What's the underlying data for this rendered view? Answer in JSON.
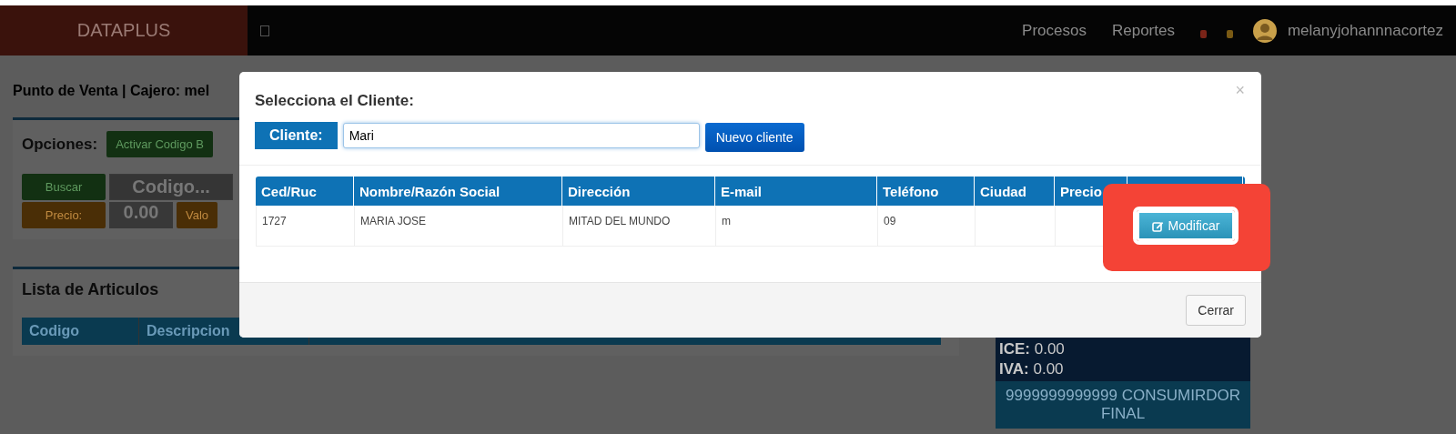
{
  "navbar": {
    "brand": "DATAPLUS",
    "menu": [
      "Procesos",
      "Reportes"
    ],
    "badges": [
      {
        "color": "#7a2418"
      },
      {
        "color": "#7a5a14"
      }
    ],
    "user": "melanyjohannnacortez"
  },
  "page": {
    "title": "Punto de Venta | Cajero: mel",
    "options_label": "Opciones:",
    "barcode_button": "Activar Codigo B",
    "search_button": "Buscar",
    "code_placeholder": "Codigo...",
    "price_button": "Precio:",
    "price_value": "0.00",
    "value_button": "Valo",
    "list_title": "Lista de Articulos",
    "list_columns": [
      "Codigo",
      "Descripcion"
    ],
    "totals": [
      {
        "label": "ICE:",
        "value": "0.00"
      },
      {
        "label": "IVA:",
        "value": "0.00"
      }
    ],
    "customer": "9999999999999 CONSUMIRDOR FINAL"
  },
  "modal": {
    "close_icon": "×",
    "title": "Selecciona el Cliente:",
    "client_label": "Cliente:",
    "client_value": "Mari",
    "new_button": "Nuevo cliente",
    "columns": [
      "Ced/Ruc",
      "Nombre/Razón Social",
      "Dirección",
      "E-mail",
      "Teléfono",
      "Ciudad",
      "Precio"
    ],
    "rows": [
      {
        "cells": [
          "1727",
          "MARIA JOSE",
          "MITAD DEL MUNDO",
          "m",
          "09",
          "",
          ""
        ],
        "action": "Modificar",
        "highlighted": true
      }
    ],
    "close_button": "Cerrar"
  }
}
